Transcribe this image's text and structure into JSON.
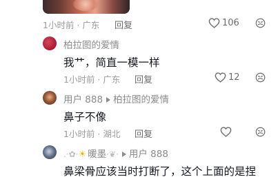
{
  "comments": [
    {
      "meta": "1小时前 · 广东",
      "reply_label": "回复",
      "likes": "106"
    },
    {
      "username": "柏拉图的爱情",
      "text": "我艹，简直一模一样",
      "meta": "1小时前 · 广东",
      "reply_label": "回复",
      "likes": "12"
    },
    {
      "username": "用户 888",
      "reply_to": "柏拉图的爱情",
      "text": "鼻子不像",
      "meta": "1小时前 · 湖北",
      "reply_label": "回复",
      "likes": ""
    },
    {
      "username": "暖墨",
      "reply_to": "用户 888",
      "text": "鼻梁骨应该当时打断了，这个上面的是捏"
    }
  ],
  "colors": {
    "text": "#161823",
    "secondary": "#9a9ba0",
    "icon": "#6b6c72"
  },
  "icons": [
    "heart-icon",
    "dislike-icon",
    "reply-arrow-icon"
  ]
}
